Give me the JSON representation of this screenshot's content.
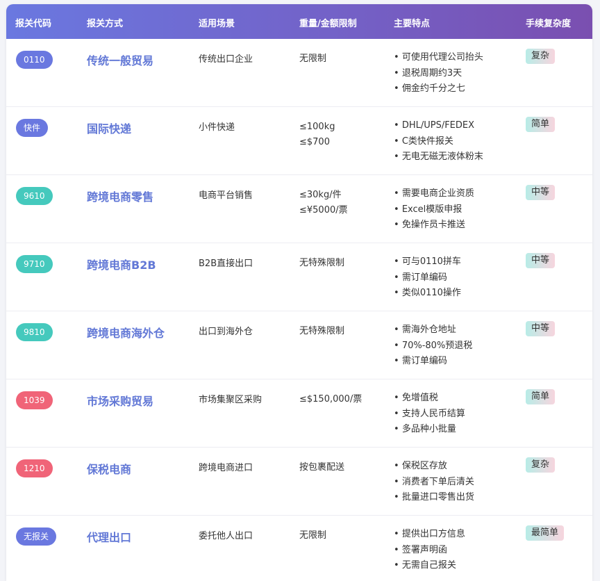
{
  "headers": [
    "报关代码",
    "报关方式",
    "适用场景",
    "重量/金额限制",
    "主要特点",
    "手续复杂度"
  ],
  "rows": [
    {
      "code": "0110",
      "color": "blue",
      "mode": "传统一般贸易",
      "scene": "传统出口企业",
      "limit": [
        "无限制"
      ],
      "features": [
        "可使用代理公司抬头",
        "退税周期约3天",
        "佣金约千分之七"
      ],
      "complexity": "复杂"
    },
    {
      "code": "快件",
      "color": "blue",
      "mode": "国际快递",
      "scene": "小件快递",
      "limit": [
        "≤100kg",
        "≤$700"
      ],
      "features": [
        "DHL/UPS/FEDEX",
        "C类快件报关",
        "无电无磁无液体粉末"
      ],
      "complexity": "简单"
    },
    {
      "code": "9610",
      "color": "teal",
      "mode": "跨境电商零售",
      "scene": "电商平台销售",
      "limit": [
        "≤30kg/件",
        "≤¥5000/票"
      ],
      "features": [
        "需要电商企业资质",
        "Excel模版申报",
        "免操作员卡推送"
      ],
      "complexity": "中等"
    },
    {
      "code": "9710",
      "color": "teal",
      "mode": "跨境电商B2B",
      "scene": "B2B直接出口",
      "limit": [
        "无特殊限制"
      ],
      "features": [
        "可与0110拼车",
        "需订单编码",
        "类似0110操作"
      ],
      "complexity": "中等"
    },
    {
      "code": "9810",
      "color": "teal",
      "mode": "跨境电商海外仓",
      "scene": "出口到海外仓",
      "limit": [
        "无特殊限制"
      ],
      "features": [
        "需海外仓地址",
        "70%-80%预退税",
        "需订单编码"
      ],
      "complexity": "中等"
    },
    {
      "code": "1039",
      "color": "red",
      "mode": "市场采购贸易",
      "scene": "市场集聚区采购",
      "limit": [
        "≤$150,000/票"
      ],
      "features": [
        "免增值税",
        "支持人民币结算",
        "多品种小批量"
      ],
      "complexity": "简单"
    },
    {
      "code": "1210",
      "color": "red",
      "mode": "保税电商",
      "scene": "跨境电商进口",
      "limit": [
        "按包裹配送"
      ],
      "features": [
        "保税区存放",
        "消费者下单后清关",
        "批量进口零售出货"
      ],
      "complexity": "复杂"
    },
    {
      "code": "无报关",
      "color": "blue",
      "mode": "代理出口",
      "scene": "委托他人出口",
      "limit": [
        "无限制"
      ],
      "features": [
        "提供出口方信息",
        "签署声明函",
        "无需自己报关"
      ],
      "complexity": "最简单"
    }
  ]
}
